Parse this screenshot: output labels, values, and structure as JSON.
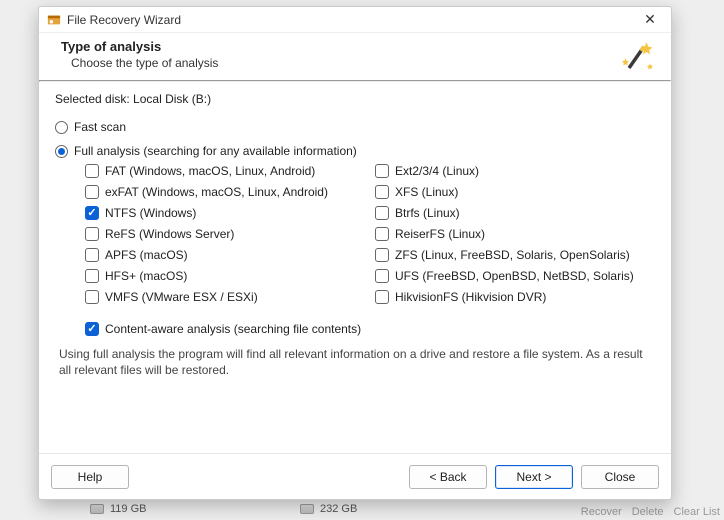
{
  "window_title": "File Recovery Wizard",
  "header": {
    "title": "Type of analysis",
    "subtitle": "Choose the type of analysis"
  },
  "selected_disk_full": "Selected disk: Local Disk (B:)",
  "radios": {
    "fast_label": "Fast scan",
    "full_label": "Full analysis (searching for any available information)"
  },
  "fs": {
    "left": [
      {
        "label": "FAT (Windows, macOS, Linux, Android)",
        "checked": false
      },
      {
        "label": "exFAT (Windows, macOS, Linux, Android)",
        "checked": false
      },
      {
        "label": "NTFS (Windows)",
        "checked": true
      },
      {
        "label": "ReFS (Windows Server)",
        "checked": false
      },
      {
        "label": "APFS (macOS)",
        "checked": false
      },
      {
        "label": "HFS+ (macOS)",
        "checked": false
      },
      {
        "label": "VMFS (VMware ESX / ESXi)",
        "checked": false
      }
    ],
    "right": [
      {
        "label": "Ext2/3/4 (Linux)",
        "checked": false
      },
      {
        "label": "XFS (Linux)",
        "checked": false
      },
      {
        "label": "Btrfs (Linux)",
        "checked": false
      },
      {
        "label": "ReiserFS (Linux)",
        "checked": false
      },
      {
        "label": "ZFS (Linux, FreeBSD, Solaris, OpenSolaris)",
        "checked": false
      },
      {
        "label": "UFS (FreeBSD, OpenBSD, NetBSD, Solaris)",
        "checked": false
      },
      {
        "label": "HikvisionFS (Hikvision DVR)",
        "checked": false
      }
    ]
  },
  "content_aware": {
    "label": "Content-aware analysis (searching file contents)",
    "checked": true
  },
  "hint": "Using full analysis the program will find all relevant information on a drive and restore a file system. As a result all relevant files will be restored.",
  "footer": {
    "help": "Help",
    "back": "< Back",
    "next": "Next >",
    "close": "Close"
  },
  "bg": {
    "disk1": "119 GB",
    "disk2": "232 GB",
    "actions": [
      "Recover",
      "Delete",
      "Clear List"
    ]
  }
}
